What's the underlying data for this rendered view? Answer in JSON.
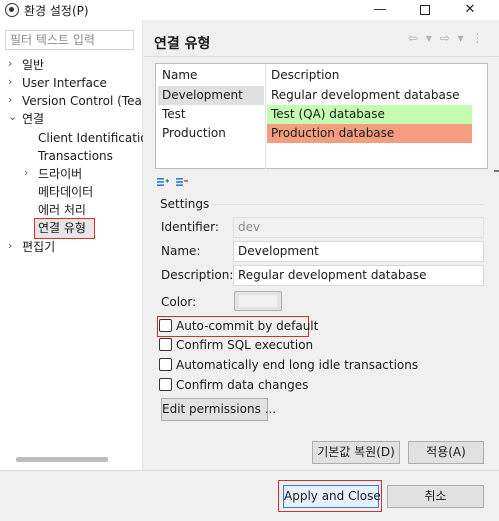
{
  "window": {
    "title": "환경 설정(P)",
    "app_icon": "eclipse-icon",
    "min_glyph": "—",
    "close_glyph": "✕"
  },
  "sidebar": {
    "filter_placeholder": "필터 텍스트 입력",
    "items": [
      {
        "label": "일반",
        "arrow": "›"
      },
      {
        "label": "User Interface",
        "arrow": "›"
      },
      {
        "label": "Version Control (Tea",
        "arrow": "›"
      },
      {
        "label": "연결",
        "arrow": "⌄"
      },
      {
        "label": "Client Identificatio"
      },
      {
        "label": "Transactions"
      },
      {
        "label": "드라이버",
        "arrow": "›"
      },
      {
        "label": "메타데이터"
      },
      {
        "label": "에러 처리"
      },
      {
        "label": "연결 유형",
        "selected": true
      },
      {
        "label": "편집기",
        "arrow": "›"
      }
    ]
  },
  "page": {
    "title": "연결 유형",
    "nav_icons": "⇦ ▾ ⇨ ▾ ⋮"
  },
  "types_table": {
    "columns": [
      "Name",
      "Description"
    ],
    "rows": [
      {
        "name": "Development",
        "description": "Regular development database",
        "color": "#ffffff"
      },
      {
        "name": "Test",
        "description": "Test (QA) database",
        "color": "#c4fcb1"
      },
      {
        "name": "Production",
        "description": "Production database",
        "color": "#f49e7f"
      }
    ],
    "selected_row_bg": "#e0e0e0",
    "toolbar_icons": [
      "add-type-icon",
      "remove-type-icon"
    ]
  },
  "settings": {
    "group_label": "Settings",
    "identifier_label": "Identifier:",
    "identifier_value": "dev",
    "name_label": "Name:",
    "name_value": "Development",
    "description_label": "Description:",
    "description_value": "Regular development database",
    "color_label": "Color:",
    "checkboxes": [
      {
        "label": "Auto-commit by default",
        "checked": false
      },
      {
        "label": "Confirm SQL execution",
        "checked": false
      },
      {
        "label": "Automatically end long idle transactions",
        "checked": false
      },
      {
        "label": "Confirm data changes",
        "checked": false
      }
    ],
    "edit_permissions_label": "Edit permissions ..."
  },
  "buttons": {
    "restore_defaults": "기본값 복원(D)",
    "apply": "적용(A)",
    "apply_and_close": "Apply and Close",
    "cancel": "취소"
  },
  "colors": {
    "highlight": "#d32f2f",
    "test_row": "#c4fcb1",
    "production_row": "#f49e7f",
    "default_button_border": "#2a7de1"
  }
}
